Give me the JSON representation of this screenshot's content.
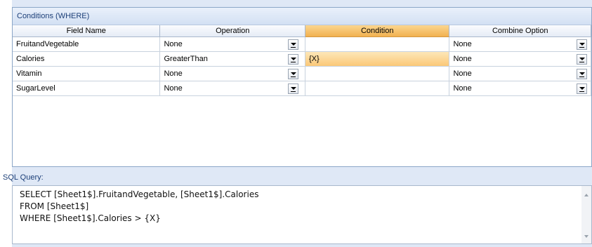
{
  "conditions_panel": {
    "title": "Conditions (WHERE)",
    "columns": [
      "Field Name",
      "Operation",
      "Condition",
      "Combine Option"
    ],
    "rows": [
      {
        "field": "FruitandVegetable",
        "operation": "None",
        "condition": "",
        "combine": "None"
      },
      {
        "field": "Calories",
        "operation": "GreaterThan",
        "condition": "{X}",
        "combine": "None"
      },
      {
        "field": "Vitamin",
        "operation": "None",
        "condition": "",
        "combine": "None"
      },
      {
        "field": "SugarLevel",
        "operation": "None",
        "condition": "",
        "combine": "None"
      }
    ]
  },
  "sql_panel": {
    "label": "SQL Query:",
    "lines": [
      "SELECT [Sheet1$].FruitandVegetable, [Sheet1$].Calories",
      "FROM [Sheet1$]",
      "WHERE [Sheet1$].Calories > {X}"
    ]
  },
  "colors": {
    "header_text": "#1c3f78",
    "highlight": "#fbc877",
    "panel_bg": "#dfe8f6"
  },
  "icons": {
    "dropdown": "dropdown-arrow-icon",
    "scroll_up": "scroll-up-icon",
    "scroll_down": "scroll-down-icon"
  }
}
